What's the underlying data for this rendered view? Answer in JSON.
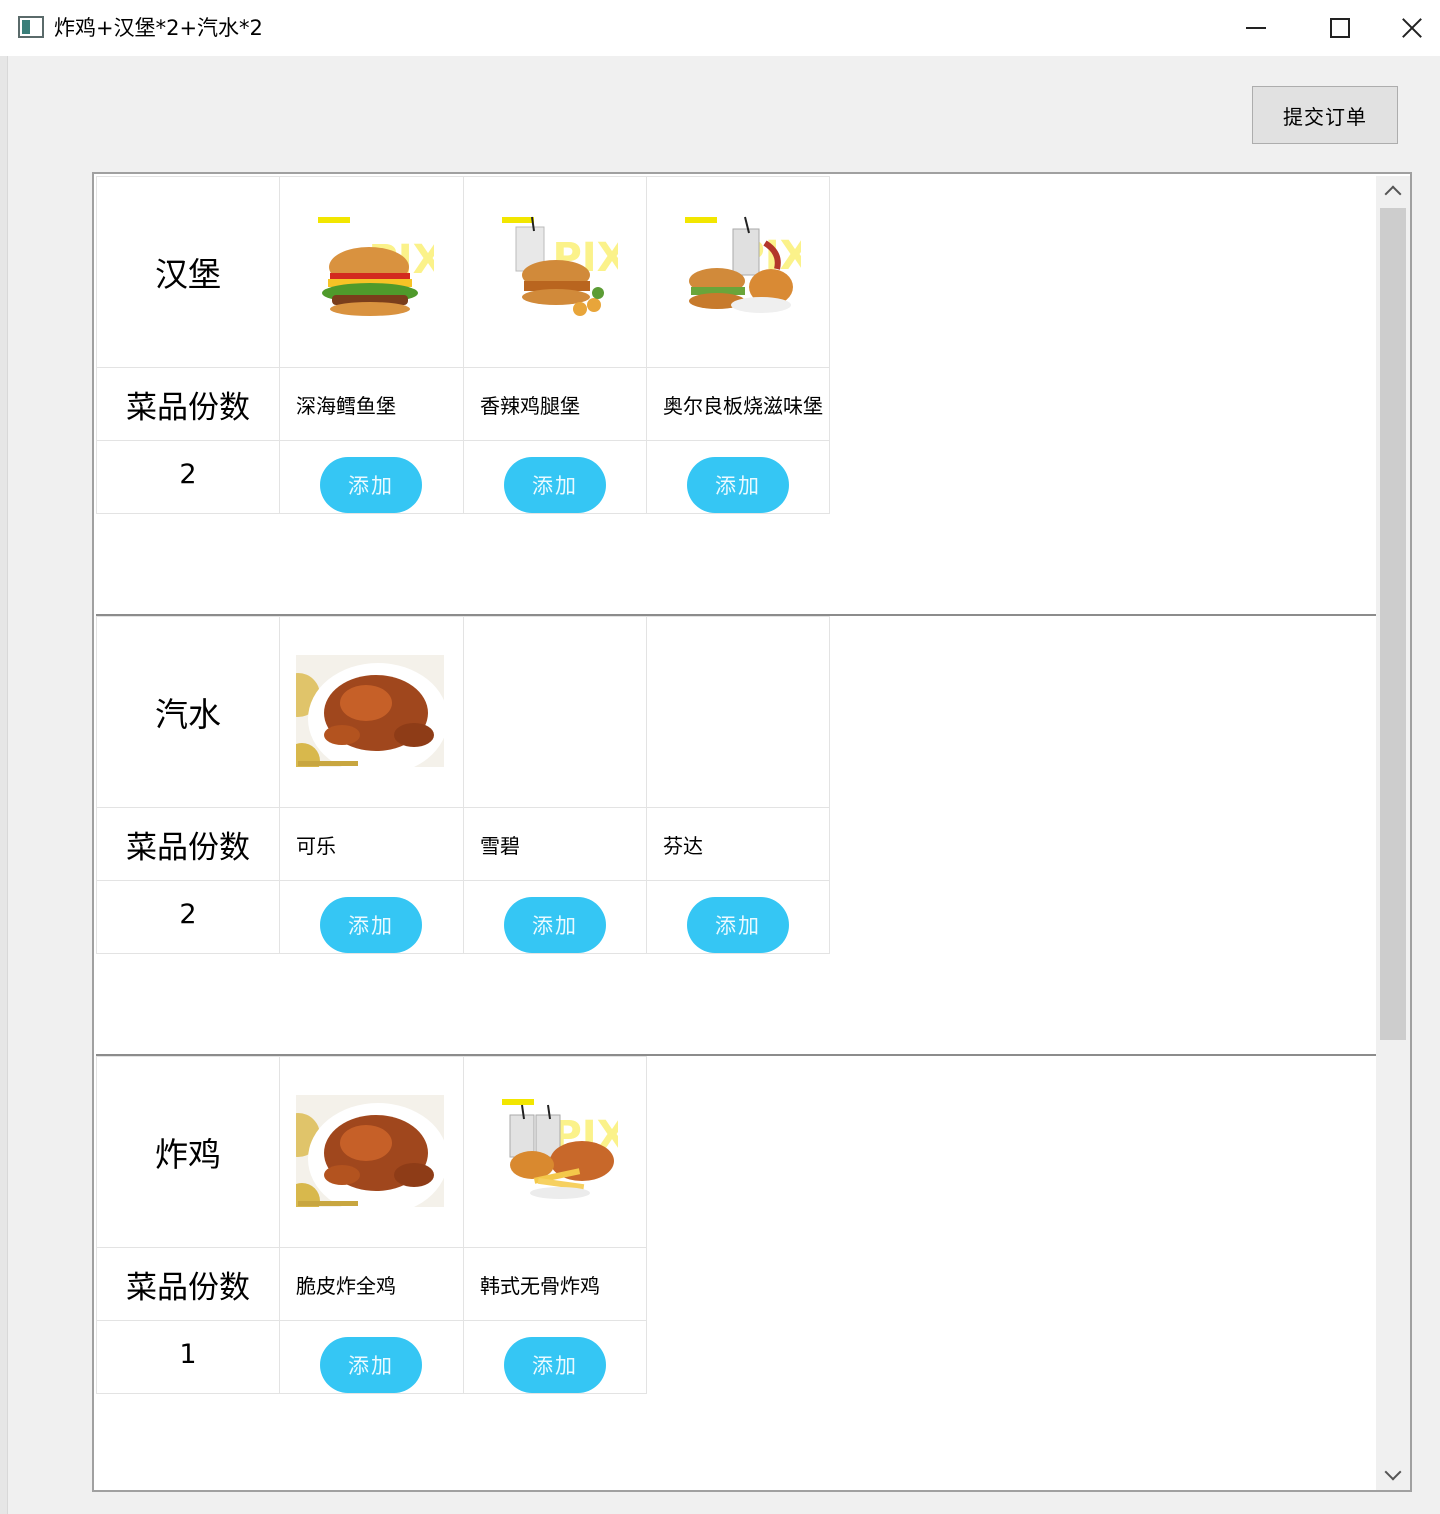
{
  "window": {
    "title": "炸鸡+汉堡*2+汽水*2"
  },
  "toolbar": {
    "submit_label": "提交订单"
  },
  "labels": {
    "portion": "菜品份数",
    "add": "添加"
  },
  "categories": [
    {
      "name": "汉堡",
      "count": "2",
      "items": [
        {
          "name": "深海鳕鱼堡",
          "image": "burger-image"
        },
        {
          "name": "香辣鸡腿堡",
          "image": "burger-combo-image"
        },
        {
          "name": "奥尔良板烧滋味堡",
          "image": "burger-chicken-combo-image"
        }
      ]
    },
    {
      "name": "汽水",
      "count": "2",
      "items": [
        {
          "name": "可乐",
          "image": "roast-chicken-image"
        },
        {
          "name": "雪碧",
          "image": ""
        },
        {
          "name": "芬达",
          "image": ""
        }
      ]
    },
    {
      "name": "炸鸡",
      "count": "1",
      "items": [
        {
          "name": "脆皮炸全鸡",
          "image": "roast-chicken-image"
        },
        {
          "name": "韩式无骨炸鸡",
          "image": "fried-chicken-combo-image"
        }
      ]
    }
  ],
  "colors": {
    "add_button": "#35c6f4",
    "window_bg": "#f0f0f0"
  }
}
